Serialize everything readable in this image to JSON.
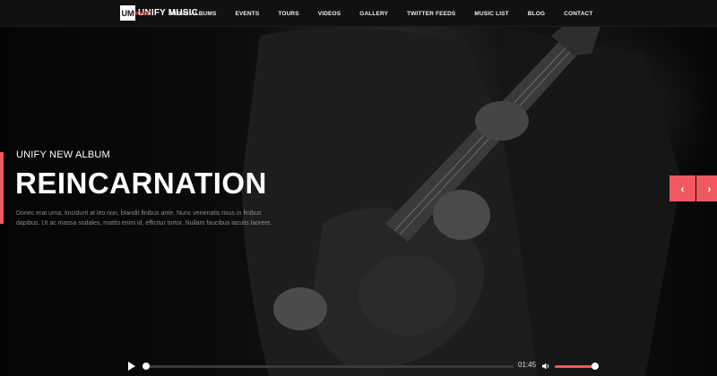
{
  "brand": {
    "badge": "UM",
    "name": "UNIFY MUSIC"
  },
  "nav": [
    {
      "label": "HOME",
      "active": true
    },
    {
      "label": "MUSIC ALBUMS"
    },
    {
      "label": "EVENTS"
    },
    {
      "label": "TOURS"
    },
    {
      "label": "VIDEOS"
    },
    {
      "label": "GALLERY"
    },
    {
      "label": "TWITTER FEEDS"
    },
    {
      "label": "MUSIC LIST"
    },
    {
      "label": "BLOG"
    },
    {
      "label": "CONTACT"
    }
  ],
  "hero": {
    "subtitle": "UNIFY NEW ALBUM",
    "title": "REINCARNATION",
    "text": "Donec erat urna, tincidunt at leo non, blandit finibus ante. Nunc venenatis risus in finibus dapibus. Ut ac massa sodales, mattis enim id, efficitur tortor. Nullam faucibus iaculis laoreet."
  },
  "slider": {
    "prev_icon": "chevron-left-icon",
    "next_icon": "chevron-right-icon",
    "prev_glyph": "‹",
    "next_glyph": "›"
  },
  "player": {
    "play_icon": "play-icon",
    "progress": 0.0,
    "time": "01:45",
    "volume_icon": "volume-icon",
    "volume": 1.0
  },
  "colors": {
    "accent": "#f0595f",
    "navbar": "#111111",
    "background": "#0e0e0e"
  }
}
